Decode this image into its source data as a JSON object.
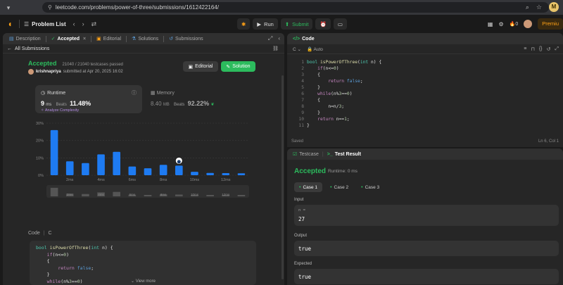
{
  "browser": {
    "url": "leetcode.com/problems/power-of-three/submissions/1612422164/",
    "profile_initial": "M"
  },
  "nav": {
    "problem_list": "Problem List",
    "run": "Run",
    "submit": "Submit",
    "streak": "0",
    "premium": "Premiu"
  },
  "left_tabs": [
    {
      "label": "Description",
      "icon": "description-icon"
    },
    {
      "label": "Accepted",
      "icon": "check-icon"
    },
    {
      "label": "Editorial",
      "icon": "book-icon"
    },
    {
      "label": "Solutions",
      "icon": "flask-icon"
    },
    {
      "label": "Submissions",
      "icon": "history-icon"
    }
  ],
  "all_submissions": "All Submissions",
  "result": {
    "status": "Accepted",
    "testcases": "21040 / 21040 testcases passed",
    "user": "krishnapriya",
    "submitted": "submitted at Apr 20, 2025 16:02",
    "editorial_btn": "Editorial",
    "solution_btn": "Solution"
  },
  "runtime": {
    "label": "Runtime",
    "value": "9",
    "unit": "ms",
    "beats_label": "Beats",
    "beats": "11.48%",
    "analyze": "Analyze Complexity"
  },
  "memory": {
    "label": "Memory",
    "value": "8.40",
    "unit": "MB",
    "beats_label": "Beats",
    "beats": "92.22%"
  },
  "chart_data": {
    "type": "bar",
    "title": "",
    "xlabel": "",
    "ylabel": "",
    "yticks": [
      "30%",
      "20%",
      "10%",
      "0%"
    ],
    "ylim": [
      0,
      30
    ],
    "xtick_labels": [
      "2ms",
      "4ms",
      "6ms",
      "8ms",
      "10ms",
      "12ms"
    ],
    "values": [
      26,
      8,
      7,
      12,
      13.5,
      5,
      4,
      6,
      5.5,
      2,
      1.3,
      1.2,
      1.1
    ],
    "highlight_index": 8,
    "grid": true
  },
  "code_section": {
    "label": "Code",
    "lang": "C",
    "view_more": "View more",
    "lines": [
      "bool isPowerOfThree(int n) {",
      "    if(n<=0)",
      "    {",
      "        return false;",
      "    }",
      "    while(n%3==0)",
      "    {",
      "        n=n/3;"
    ]
  },
  "editor": {
    "title": "Code",
    "lang": "C",
    "mode": "Auto",
    "lines": [
      "bool isPowerOfThree(int n) {",
      "    if(n<=0)",
      "    {",
      "        return false;",
      "    }",
      "    while(n%3==0)",
      "    {",
      "        n=n/3;",
      "    }",
      "    return n==1;",
      "}"
    ],
    "saved": "Saved",
    "position": "Ln 6, Col 1"
  },
  "results": {
    "tab_testcase": "Testcase",
    "tab_result": "Test Result",
    "status": "Accepted",
    "runtime": "Runtime: 0 ms",
    "cases": [
      "Case 1",
      "Case 2",
      "Case 3"
    ],
    "input_label": "Input",
    "input_var": "n =",
    "input_value": "27",
    "output_label": "Output",
    "output_value": "true",
    "expected_label": "Expected",
    "expected_value": "true"
  },
  "colors": {
    "accent_green": "#2cbb5d",
    "brand_orange": "#ffa116",
    "bar_blue": "#1e7bf2"
  }
}
